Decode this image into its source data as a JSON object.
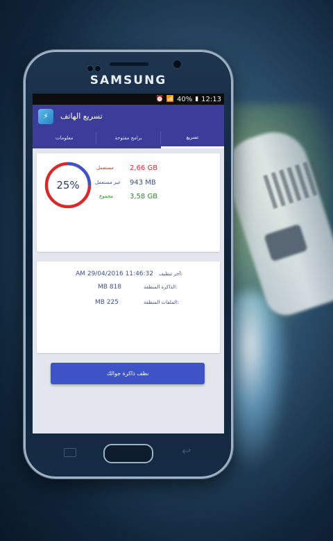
{
  "device": {
    "brand": "SAMSUNG"
  },
  "status_bar": {
    "battery": "40%",
    "time": "12:13"
  },
  "app": {
    "title": "تسريع الهاتف"
  },
  "tabs": [
    {
      "label": "معلومات",
      "active": false
    },
    {
      "label": "برامج مفتوحة",
      "active": false
    },
    {
      "label": "تسريع",
      "active": true
    }
  ],
  "memory": {
    "percent_label": "25%",
    "percent": 25,
    "used_label": "مستعمل",
    "used_value": "2,66 GB",
    "free_label": "غير مستعمل",
    "free_value": "943 MB",
    "total_label": "مجموع",
    "total_value": "3,58 GB"
  },
  "info": {
    "last_clean_label": "آخر تنظيف:",
    "last_clean_value": "AM 29/04/2016 11:46:32",
    "freed_memory_label": "الذاكرة المنظفة:",
    "freed_memory_value": "MB 818",
    "cleaned_files_label": "الملفات المنظفة:",
    "cleaned_files_value": "MB 225"
  },
  "actions": {
    "clean_button": "نظف ذاكرة جوالك"
  },
  "colors": {
    "primary": "#3c3c9a",
    "button": "#3e53c6",
    "used": "#d62b2b",
    "free": "#3b4f8a",
    "total": "#2e8a2e",
    "ring_used": "#3e53c6",
    "ring_free": "#d62b2b"
  }
}
